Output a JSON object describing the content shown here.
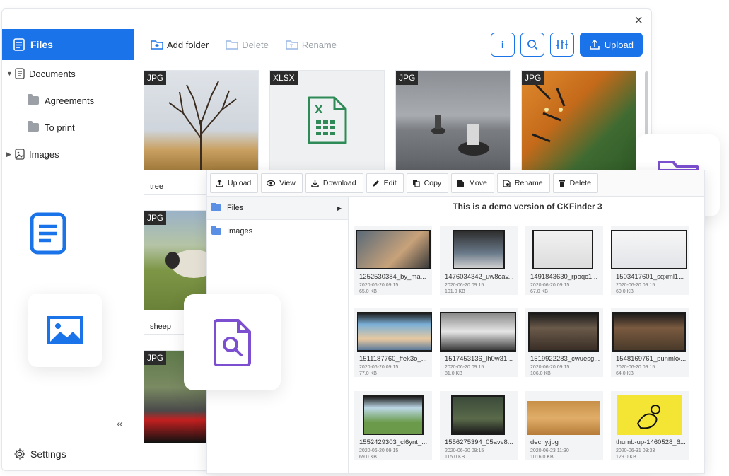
{
  "window": {
    "close": "×"
  },
  "sidebar": {
    "files": "Files",
    "documents": "Documents",
    "agreements": "Agreements",
    "to_print": "To print",
    "images": "Images",
    "collapse": "«",
    "settings": "Settings"
  },
  "toolbar": {
    "add_folder": "Add folder",
    "delete": "Delete",
    "rename": "Rename",
    "info": "i",
    "upload": "Upload"
  },
  "grid": [
    {
      "tag": "JPG",
      "caption": "tree"
    },
    {
      "tag": "XLSX",
      "caption": ""
    },
    {
      "tag": "JPG",
      "caption": ""
    },
    {
      "tag": "JPG",
      "caption": ""
    },
    {
      "tag": "JPG",
      "caption": "sheep"
    },
    {
      "tag": "JPG",
      "caption": ""
    }
  ],
  "front": {
    "buttons": [
      "Upload",
      "View",
      "Download",
      "Edit",
      "Copy",
      "Move",
      "Rename",
      "Delete"
    ],
    "folders": [
      "Files",
      "Images"
    ],
    "title": "This is a demo version of CKFinder 3",
    "files": [
      {
        "name": "1252530384_by_ma...",
        "date": "2020-06-20 09:15",
        "size": "65.0 KB"
      },
      {
        "name": "1476034342_uw8cav...",
        "date": "2020-06-20 09:15",
        "size": "101.0 KB"
      },
      {
        "name": "1491843630_rpoqc1...",
        "date": "2020-06-20 09:15",
        "size": "67.0 KB"
      },
      {
        "name": "1503417601_sqxml1...",
        "date": "2020-06-20 09:15",
        "size": "60.0 KB"
      },
      {
        "name": "1511187760_ffek3o_...",
        "date": "2020-06-20 09:15",
        "size": "77.0 KB"
      },
      {
        "name": "1517453136_lh0w31...",
        "date": "2020-06-20 09:15",
        "size": "81.0 KB"
      },
      {
        "name": "1519922283_cwuesg...",
        "date": "2020-06-20 09:15",
        "size": "106.0 KB"
      },
      {
        "name": "1548169761_punmkx...",
        "date": "2020-06-20 09:15",
        "size": "64.0 KB"
      },
      {
        "name": "1552429303_cl6ynt_...",
        "date": "2020-06-20 09:15",
        "size": "69.0 KB"
      },
      {
        "name": "1556275394_05avv8...",
        "date": "2020-06-20 09:15",
        "size": "115.0 KB"
      },
      {
        "name": "dechy.jpg",
        "date": "2020-06-23 11:30",
        "size": "1016.0 KB"
      },
      {
        "name": "thumb-up-1460528_6...",
        "date": "2020-06-31 09:33",
        "size": "129.0 KB"
      }
    ]
  },
  "colors": {
    "accent": "#1a73e8",
    "purple": "#7b4fd0"
  },
  "icons": [
    "file-icon",
    "document-icon",
    "folder-icon",
    "image-icon",
    "gear-icon",
    "search-icon",
    "filter-icon",
    "upload-icon",
    "search-file-icon"
  ]
}
